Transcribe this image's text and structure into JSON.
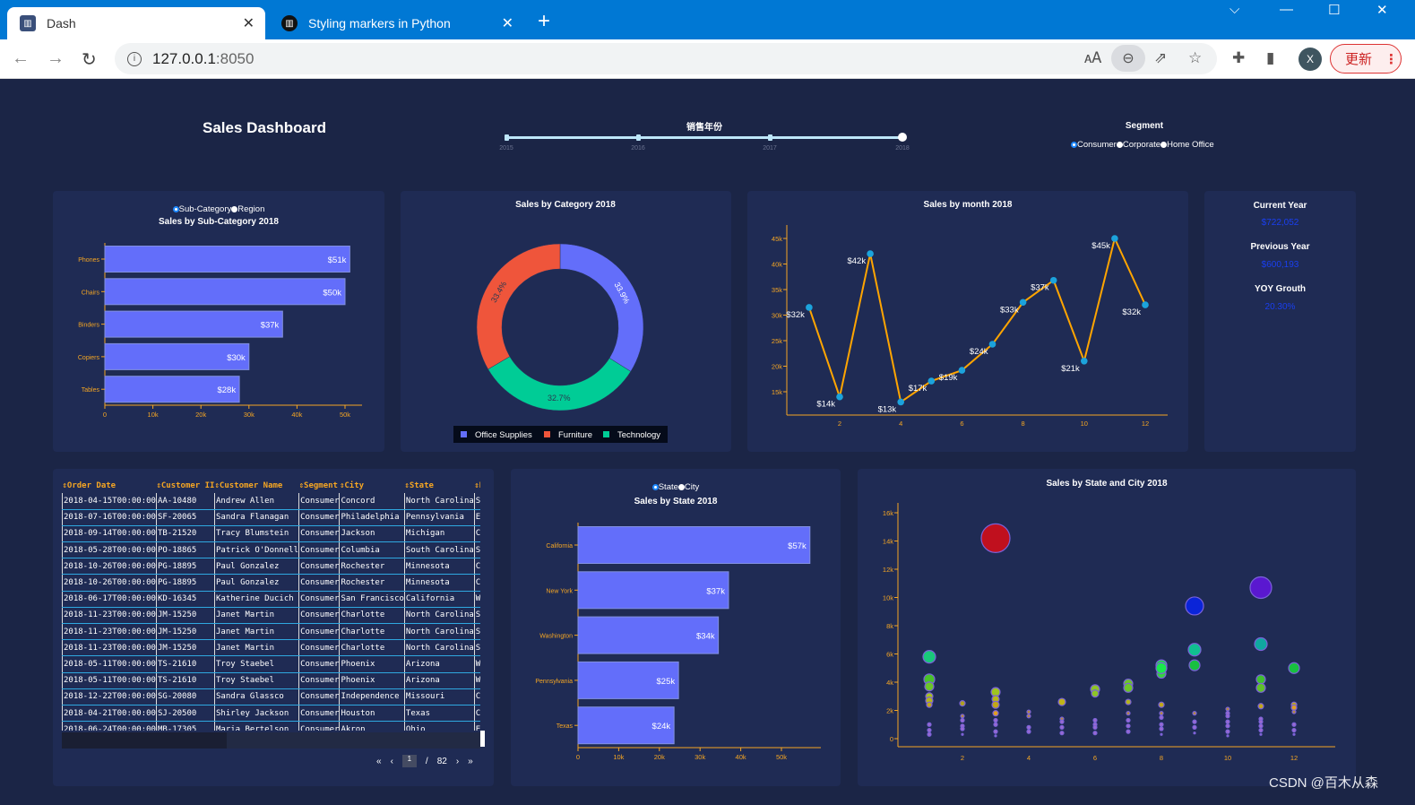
{
  "browser": {
    "tabs": [
      {
        "label": "Dash",
        "icon": "dash-icon"
      },
      {
        "label": "Styling markers in Python",
        "icon": "plotly-icon"
      }
    ],
    "url_host": "127.0.0.1",
    "url_port": ":8050",
    "update_label": "更新",
    "avatar_letter": "X",
    "tab_bar_color": "#0078d4"
  },
  "header": {
    "title": "Sales Dashboard",
    "slider": {
      "label": "销售年份",
      "marks": [
        "2015",
        "2016",
        "2017",
        "2018"
      ],
      "value": "2018"
    },
    "segment": {
      "label": "Segment",
      "options": [
        "Consumer",
        "Corporate",
        "Home Office"
      ],
      "selected": "Consumer"
    }
  },
  "subcat_panel": {
    "radio": [
      "Sub-Category",
      "Region"
    ],
    "selected": "Sub-Category"
  },
  "state_panel": {
    "radio": [
      "State",
      "City"
    ],
    "selected": "State"
  },
  "kpis": [
    {
      "title": "Current Year",
      "value": "$722,052"
    },
    {
      "title": "Previous Year",
      "value": "$600,193"
    },
    {
      "title": "YOY Grouth",
      "value": "20.30%"
    }
  ],
  "kpi_color": "#1a3ff0",
  "table": {
    "columns": [
      "Order Date",
      "Customer ID",
      "Customer Name",
      "Segment",
      "City",
      "State",
      "Region"
    ],
    "column_display": [
      "Order Date",
      "Customer II",
      "Customer Name",
      "Segment",
      "City",
      "State",
      "Regio"
    ],
    "rows": [
      [
        "2018-04-15T00:00:00",
        "AA-10480",
        "Andrew Allen",
        "Consumer",
        "Concord",
        "North Carolina",
        "South"
      ],
      [
        "2018-07-16T00:00:00",
        "SF-20065",
        "Sandra Flanagan",
        "Consumer",
        "Philadelphia",
        "Pennsylvania",
        "East"
      ],
      [
        "2018-09-14T00:00:00",
        "TB-21520",
        "Tracy Blumstein",
        "Consumer",
        "Jackson",
        "Michigan",
        "Centr"
      ],
      [
        "2018-05-28T00:00:00",
        "PO-18865",
        "Patrick O'Donnell",
        "Consumer",
        "Columbia",
        "South Carolina",
        "South"
      ],
      [
        "2018-10-26T00:00:00",
        "PG-18895",
        "Paul Gonzalez",
        "Consumer",
        "Rochester",
        "Minnesota",
        "Centr"
      ],
      [
        "2018-10-26T00:00:00",
        "PG-18895",
        "Paul Gonzalez",
        "Consumer",
        "Rochester",
        "Minnesota",
        "Centr"
      ],
      [
        "2018-06-17T00:00:00",
        "KD-16345",
        "Katherine Ducich",
        "Consumer",
        "San Francisco",
        "California",
        "West"
      ],
      [
        "2018-11-23T00:00:00",
        "JM-15250",
        "Janet Martin",
        "Consumer",
        "Charlotte",
        "North Carolina",
        "South"
      ],
      [
        "2018-11-23T00:00:00",
        "JM-15250",
        "Janet Martin",
        "Consumer",
        "Charlotte",
        "North Carolina",
        "South"
      ],
      [
        "2018-11-23T00:00:00",
        "JM-15250",
        "Janet Martin",
        "Consumer",
        "Charlotte",
        "North Carolina",
        "South"
      ],
      [
        "2018-05-11T00:00:00",
        "TS-21610",
        "Troy Staebel",
        "Consumer",
        "Phoenix",
        "Arizona",
        "West"
      ],
      [
        "2018-05-11T00:00:00",
        "TS-21610",
        "Troy Staebel",
        "Consumer",
        "Phoenix",
        "Arizona",
        "West"
      ],
      [
        "2018-12-22T00:00:00",
        "SG-20080",
        "Sandra Glassco",
        "Consumer",
        "Independence",
        "Missouri",
        "Centr"
      ],
      [
        "2018-04-21T00:00:00",
        "SJ-20500",
        "Shirley Jackson",
        "Consumer",
        "Houston",
        "Texas",
        "Centr"
      ],
      [
        "2018-06-24T00:00:00",
        "MB-17305",
        "Maria Bertelson",
        "Consumer",
        "Akron",
        "Ohio",
        "East"
      ]
    ],
    "pager": {
      "first": "«",
      "prev": "‹",
      "current": "1",
      "sep": "/",
      "total": "82",
      "next": "›",
      "last": "»"
    }
  },
  "watermark": "CSDN @百木从森",
  "chart_data": [
    {
      "type": "bar",
      "orientation": "h",
      "title": "Sales by Sub-Category 2018",
      "categories": [
        "Phones",
        "Chairs",
        "Binders",
        "Copiers",
        "Tables"
      ],
      "values": [
        51,
        50,
        37,
        30,
        28
      ],
      "labels": [
        "$51k",
        "$50k",
        "$37k",
        "$30k",
        "$28k"
      ],
      "xticks": [
        "0",
        "10k",
        "20k",
        "30k",
        "40k",
        "50k"
      ],
      "xlim": [
        0,
        53
      ],
      "unit": "k",
      "color": "#636efa"
    },
    {
      "type": "pie",
      "hole": true,
      "title": "Sales by Category 2018",
      "categories": [
        "Office Supplies",
        "Technology",
        "Furniture"
      ],
      "values": [
        33.9,
        32.7,
        33.4
      ],
      "labels": [
        "33.9%",
        "32.7%",
        "33.4%"
      ],
      "colors": [
        "#636efa",
        "#00cc96",
        "#ef553b"
      ],
      "legend": [
        "Office Supplies",
        "Furniture",
        "Technology"
      ],
      "legend_colors": [
        "#636efa",
        "#ef553b",
        "#00cc96"
      ],
      "legend_position": "bottom"
    },
    {
      "type": "line",
      "title": "Sales by month 2018",
      "x": [
        1,
        2,
        3,
        4,
        5,
        6,
        7,
        8,
        9,
        10,
        11,
        12
      ],
      "y": [
        31.5,
        14,
        42,
        13,
        17.1,
        19.2,
        24.3,
        32.5,
        36.8,
        21,
        45,
        32
      ],
      "labels": [
        "$32k",
        "$14k",
        "$42k",
        "$13k",
        "$17k",
        "$19k",
        "$24k",
        "$33k",
        "$37k",
        "$21k",
        "$45k",
        "$32k"
      ],
      "xticks": [
        2,
        4,
        6,
        8,
        10,
        12
      ],
      "yticks": [
        "15k",
        "20k",
        "25k",
        "30k",
        "35k",
        "40k",
        "45k"
      ],
      "line_color": "#ffa500",
      "marker_color": "#1ca3dc"
    },
    {
      "type": "bar",
      "orientation": "h",
      "title": "Sales by State 2018",
      "categories": [
        "California",
        "New York",
        "Washington",
        "Pennsylvania",
        "Texas"
      ],
      "values": [
        57,
        37,
        34.5,
        24.7,
        23.6
      ],
      "labels": [
        "$57k",
        "$37k",
        "$34k",
        "$25k",
        "$24k"
      ],
      "xticks": [
        "0",
        "10k",
        "20k",
        "30k",
        "40k",
        "50k"
      ],
      "xlim": [
        0,
        60
      ],
      "unit": "k",
      "color": "#636efa"
    },
    {
      "type": "scatter",
      "title": "Sales by State and City 2018",
      "xticks": [
        2,
        4,
        6,
        8,
        10,
        12
      ],
      "yticks": [
        "0",
        "2k",
        "4k",
        "6k",
        "8k",
        "10k",
        "12k",
        "14k",
        "16k"
      ],
      "ylim": [
        -1,
        16.5
      ],
      "points": [
        [
          1,
          5.8,
          7,
          "#19c87a"
        ],
        [
          1,
          4.2,
          6,
          "#49c22a"
        ],
        [
          1,
          3.7,
          5,
          "#6cc42a"
        ],
        [
          1,
          3.0,
          4,
          "#a8c21e"
        ],
        [
          1,
          2.7,
          4,
          "#b3b51a"
        ],
        [
          1,
          2.4,
          3,
          "#c0a71a"
        ],
        [
          1,
          1.0,
          2
        ],
        [
          1,
          0.6,
          2
        ],
        [
          1,
          0.3,
          2
        ],
        [
          2,
          2.5,
          3,
          "#b0a020"
        ],
        [
          2,
          1.6,
          2,
          "#b38a40"
        ],
        [
          2,
          1.3,
          2
        ],
        [
          2,
          0.9,
          2
        ],
        [
          2,
          0.7,
          2
        ],
        [
          2,
          0.3,
          1
        ],
        [
          3,
          14.2,
          16,
          "#c0101e"
        ],
        [
          3,
          3.3,
          5,
          "#9fc420"
        ],
        [
          3,
          2.8,
          4,
          "#b8b818"
        ],
        [
          3,
          2.4,
          4,
          "#c0a71a"
        ],
        [
          3,
          1.8,
          3,
          "#e0a020"
        ],
        [
          3,
          1.3,
          2
        ],
        [
          3,
          1.0,
          2
        ],
        [
          3,
          0.5,
          2
        ],
        [
          3,
          0.2,
          1
        ],
        [
          4,
          1.9,
          2,
          "#b38a40"
        ],
        [
          4,
          1.6,
          2,
          "#b38a40"
        ],
        [
          4,
          0.8,
          2
        ],
        [
          4,
          0.5,
          2
        ],
        [
          5,
          2.6,
          4,
          "#c0b418"
        ],
        [
          5,
          1.4,
          2,
          "#b38a40"
        ],
        [
          5,
          1.2,
          2
        ],
        [
          5,
          0.8,
          2
        ],
        [
          5,
          0.4,
          2
        ],
        [
          6,
          3.5,
          5,
          "#8ec428"
        ],
        [
          6,
          3.2,
          4,
          "#8ec428"
        ],
        [
          6,
          1.3,
          2
        ],
        [
          6,
          1.0,
          2
        ],
        [
          6,
          0.8,
          2
        ],
        [
          6,
          0.4,
          2
        ],
        [
          7,
          3.9,
          5,
          "#6cc42a"
        ],
        [
          7,
          3.6,
          5,
          "#6cc42a"
        ],
        [
          7,
          2.6,
          3,
          "#b3b51a"
        ],
        [
          7,
          1.8,
          2,
          "#b38a40"
        ],
        [
          7,
          1.3,
          2
        ],
        [
          7,
          0.9,
          2
        ],
        [
          7,
          0.5,
          2
        ],
        [
          8,
          5.2,
          6,
          "#23d84a"
        ],
        [
          8,
          4.6,
          5,
          "#37d040"
        ],
        [
          8,
          5.0,
          6,
          "#1ae84c"
        ],
        [
          8,
          2.4,
          3,
          "#c0a71a"
        ],
        [
          8,
          1.8,
          2,
          "#b38a40"
        ],
        [
          8,
          1.5,
          2
        ],
        [
          8,
          1.0,
          2
        ],
        [
          8,
          0.7,
          2
        ],
        [
          8,
          0.3,
          1
        ],
        [
          9,
          9.4,
          10,
          "#0a24d8"
        ],
        [
          9,
          6.3,
          7,
          "#10c090"
        ],
        [
          9,
          5.2,
          6,
          "#18c040"
        ],
        [
          9,
          1.8,
          2,
          "#b38a40"
        ],
        [
          9,
          1.2,
          2
        ],
        [
          9,
          0.8,
          2
        ],
        [
          9,
          0.4,
          1
        ],
        [
          10,
          2.1,
          2,
          "#b38a40"
        ],
        [
          10,
          1.8,
          2
        ],
        [
          10,
          1.6,
          2
        ],
        [
          10,
          1.2,
          2
        ],
        [
          10,
          0.9,
          2
        ],
        [
          10,
          0.5,
          2
        ],
        [
          10,
          0.2,
          1
        ],
        [
          11,
          10.7,
          12,
          "#5a18d0"
        ],
        [
          11,
          6.7,
          7,
          "#10a8a0"
        ],
        [
          11,
          4.2,
          5,
          "#40c030"
        ],
        [
          11,
          3.6,
          5,
          "#60c02a"
        ],
        [
          11,
          2.3,
          3,
          "#c0a71a"
        ],
        [
          11,
          1.4,
          2
        ],
        [
          11,
          1.2,
          2
        ],
        [
          11,
          0.9,
          2
        ],
        [
          11,
          0.6,
          2
        ],
        [
          11,
          0.3,
          1
        ],
        [
          12,
          5.0,
          6,
          "#18c040"
        ],
        [
          12,
          2.4,
          3,
          "#c0a71a"
        ],
        [
          12,
          2.2,
          3,
          "#e0a020"
        ],
        [
          12,
          1.9,
          2,
          "#b38a40"
        ],
        [
          12,
          1.0,
          2
        ],
        [
          12,
          0.6,
          2
        ],
        [
          12,
          0.3,
          1
        ]
      ]
    }
  ],
  "axis_color": "#f5a623"
}
